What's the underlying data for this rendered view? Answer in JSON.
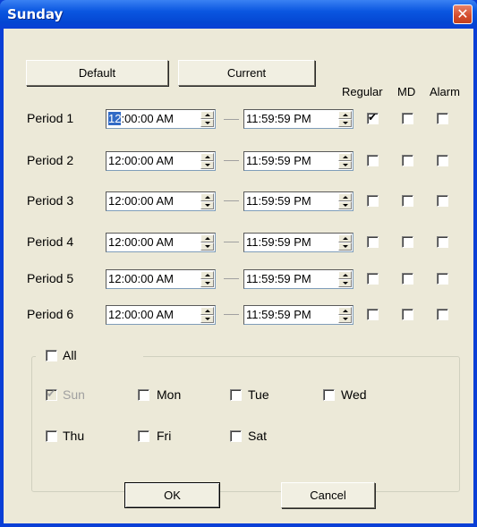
{
  "window": {
    "title": "Sunday",
    "close_icon": "close-icon"
  },
  "buttons": {
    "default": "Default",
    "current": "Current",
    "ok": "OK",
    "cancel": "Cancel"
  },
  "headers": {
    "regular": "Regular",
    "md": "MD",
    "alarm": "Alarm"
  },
  "periods": [
    {
      "label": "Period 1",
      "start": "12:00:00 AM",
      "start_sel": "12",
      "start_rest": ":00:00 AM",
      "end": "11:59:59 PM",
      "regular": true,
      "md": false,
      "alarm": false
    },
    {
      "label": "Period 2",
      "start": "12:00:00 AM",
      "end": "11:59:59 PM",
      "regular": false,
      "md": false,
      "alarm": false
    },
    {
      "label": "Period 3",
      "start": "12:00:00 AM",
      "end": "11:59:59 PM",
      "regular": false,
      "md": false,
      "alarm": false
    },
    {
      "label": "Period 4",
      "start": "12:00:00 AM",
      "end": "11:59:59 PM",
      "regular": false,
      "md": false,
      "alarm": false
    },
    {
      "label": "Period 5",
      "start": "12:00:00 AM",
      "end": "11:59:59 PM",
      "regular": false,
      "md": false,
      "alarm": false
    },
    {
      "label": "Period 6",
      "start": "12:00:00 AM",
      "end": "11:59:59 PM",
      "regular": false,
      "md": false,
      "alarm": false
    }
  ],
  "days": {
    "all": {
      "label": "All",
      "checked": false
    },
    "items": [
      {
        "label": "Sun",
        "checked": true,
        "disabled": true
      },
      {
        "label": "Mon",
        "checked": false,
        "disabled": false
      },
      {
        "label": "Tue",
        "checked": false,
        "disabled": false
      },
      {
        "label": "Wed",
        "checked": false,
        "disabled": false
      },
      {
        "label": "Thu",
        "checked": false,
        "disabled": false
      },
      {
        "label": "Fri",
        "checked": false,
        "disabled": false
      },
      {
        "label": "Sat",
        "checked": false,
        "disabled": false
      }
    ]
  },
  "colors": {
    "titlebar": "#0a56e0",
    "client": "#ece9d8",
    "close": "#d34b2c",
    "selection": "#316ac5"
  }
}
